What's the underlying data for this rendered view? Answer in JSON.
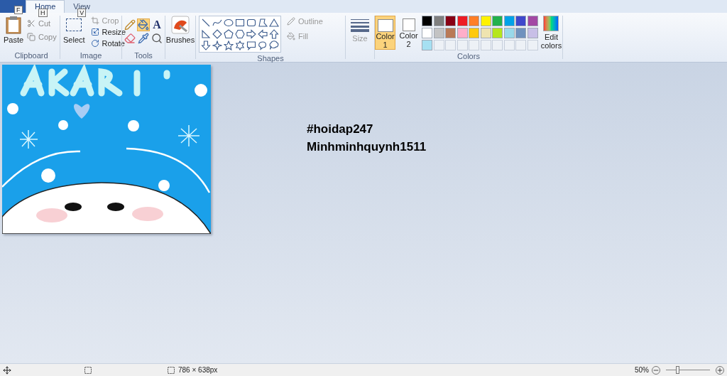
{
  "keytips": [
    "F",
    "H",
    "V"
  ],
  "tabs": [
    {
      "label": "Home",
      "selected": true
    },
    {
      "label": "View",
      "selected": false
    }
  ],
  "clipboard": {
    "paste": "Paste",
    "cut": "Cut",
    "copy": "Copy",
    "label": "Clipboard"
  },
  "image": {
    "select": "Select",
    "crop": "Crop",
    "resize": "Resize",
    "rotate": "Rotate",
    "label": "Image"
  },
  "tools": {
    "items": [
      {
        "kind": "pencil",
        "selected": false
      },
      {
        "kind": "fill",
        "selected": true
      },
      {
        "kind": "text",
        "glyph": "A",
        "selected": false
      },
      {
        "kind": "eraser",
        "selected": false
      },
      {
        "kind": "picker",
        "selected": false
      },
      {
        "kind": "magnifier",
        "selected": false
      }
    ],
    "label": "Tools"
  },
  "brushes": "Brushes",
  "shapes": {
    "label": "Shapes",
    "outline": "Outline",
    "fill": "Fill"
  },
  "size": "Size",
  "color1": {
    "label": "Color",
    "number": "1",
    "selected": true
  },
  "color2": {
    "label": "Color",
    "number": "2",
    "selected": false
  },
  "palette": [
    {
      "kind": "color",
      "color": "#000000"
    },
    {
      "kind": "color",
      "color": "#7f7f7f"
    },
    {
      "kind": "color",
      "color": "#880015"
    },
    {
      "kind": "color",
      "color": "#ed1c24"
    },
    {
      "kind": "color",
      "color": "#ff7f27"
    },
    {
      "kind": "color",
      "color": "#fff200"
    },
    {
      "kind": "color",
      "color": "#22b14c"
    },
    {
      "kind": "color",
      "color": "#00a2e8"
    },
    {
      "kind": "color",
      "color": "#3f48cc"
    },
    {
      "kind": "color",
      "color": "#a349a4"
    },
    {
      "kind": "color",
      "color": "#ffffff"
    },
    {
      "kind": "color",
      "color": "#c3c3c3"
    },
    {
      "kind": "color",
      "color": "#b97a57"
    },
    {
      "kind": "color",
      "color": "#ffaec9"
    },
    {
      "kind": "color",
      "color": "#ffc90e"
    },
    {
      "kind": "color",
      "color": "#efe4b0"
    },
    {
      "kind": "color",
      "color": "#b5e61d"
    },
    {
      "kind": "color",
      "color": "#99d9ea"
    },
    {
      "kind": "color",
      "color": "#7092be"
    },
    {
      "kind": "color",
      "color": "#c8bfe7"
    },
    {
      "kind": "color",
      "color": "#a6e0f2"
    },
    {
      "kind": "empty"
    },
    {
      "kind": "empty"
    },
    {
      "kind": "empty"
    },
    {
      "kind": "empty"
    },
    {
      "kind": "empty"
    },
    {
      "kind": "empty"
    },
    {
      "kind": "empty"
    },
    {
      "kind": "empty"
    },
    {
      "kind": "empty"
    }
  ],
  "edit_colors": "Edit colors",
  "colors_label": "Colors",
  "canvas": {
    "image": {
      "kind": "picture"
    },
    "text_lines": [
      "#hoidap247",
      "Minhminhquynh1511"
    ]
  },
  "status_bar": {
    "dimensions": "786 × 638px",
    "zoom": "50%",
    "level": 0.25
  }
}
